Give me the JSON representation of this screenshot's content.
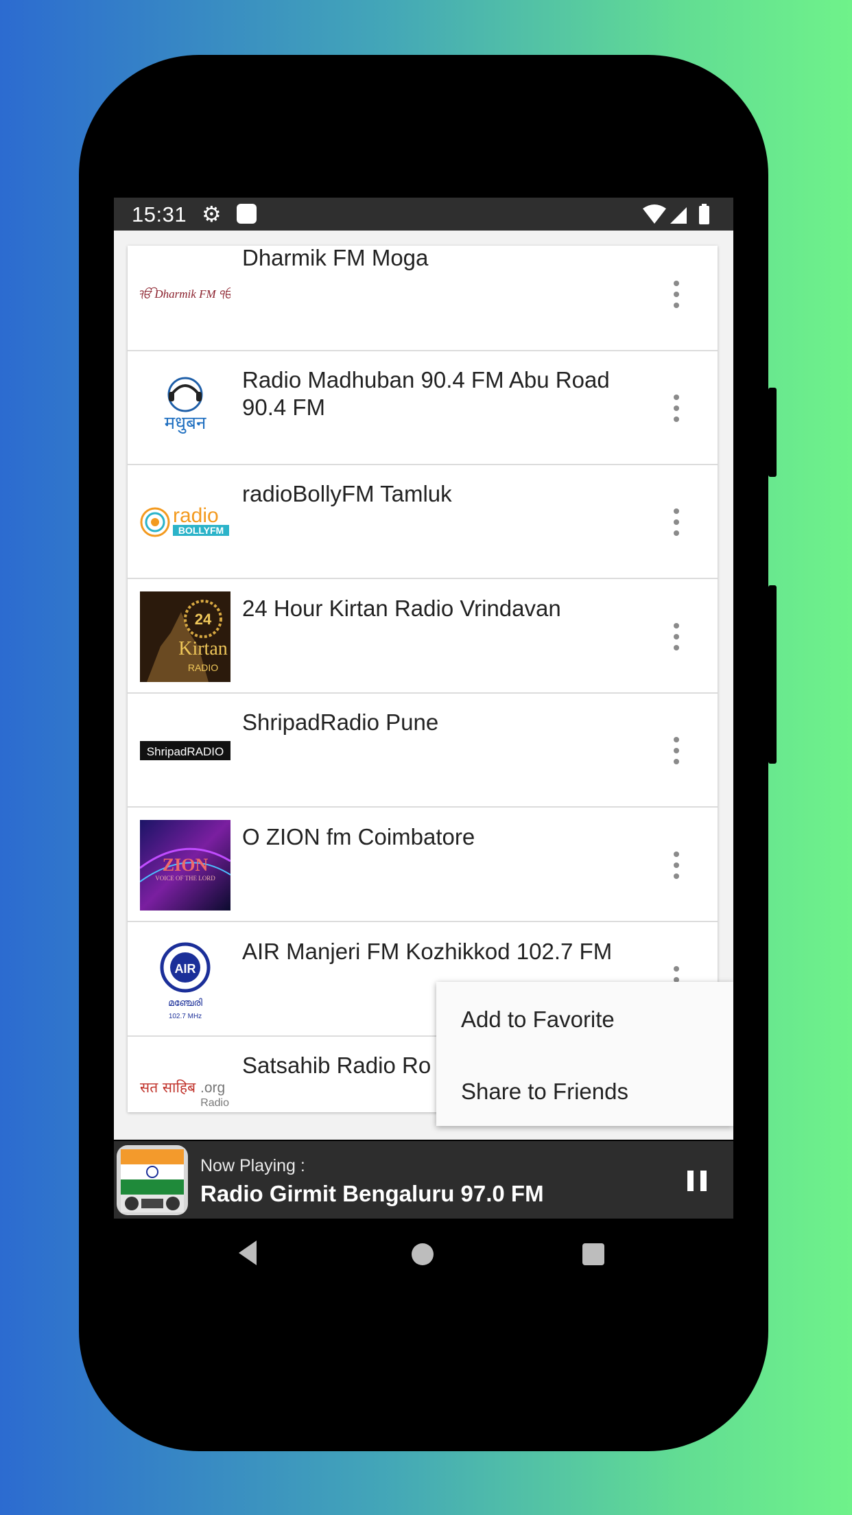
{
  "status_bar": {
    "time": "15:31",
    "icons": [
      "gear-icon",
      "notification-icon",
      "wifi-icon",
      "signal-icon",
      "battery-icon"
    ]
  },
  "stations": [
    {
      "name": "Dharmik FM Moga",
      "logo_text": "ੴ Dharmik FM ੴ"
    },
    {
      "name": "Radio Madhuban 90.4 FM Abu Road 90.4 FM",
      "logo_text": "मधुबन"
    },
    {
      "name": "radioBollyFM Tamluk",
      "logo_text": "radio BOLLYFM"
    },
    {
      "name": "24 Hour Kirtan Radio Vrindavan",
      "logo_text": "24 Hour Kirtan RADIO"
    },
    {
      "name": "ShripadRadio Pune",
      "logo_text": "ShripadRADIO"
    },
    {
      "name": "O ZION fm Coimbatore",
      "logo_text": "ZION VOICE OF THE LORD"
    },
    {
      "name": "AIR Manjeri FM Kozhikkod 102.7 FM",
      "logo_text": "AIR 102.7 MHz"
    },
    {
      "name": "Satsahib Radio Ro",
      "logo_text": "सत साहिब.org Radio"
    }
  ],
  "context_menu": {
    "items": [
      "Add to Favorite",
      "Share to Friends"
    ]
  },
  "player": {
    "label": "Now Playing :",
    "title": "Radio Girmit Bengaluru 97.0 FM",
    "state": "playing"
  },
  "colors": {
    "background_gradient": [
      "#2c6bd0",
      "#6ff28a"
    ],
    "status_bar": "#2f2f2f",
    "player_bar": "#2d2d2d"
  }
}
